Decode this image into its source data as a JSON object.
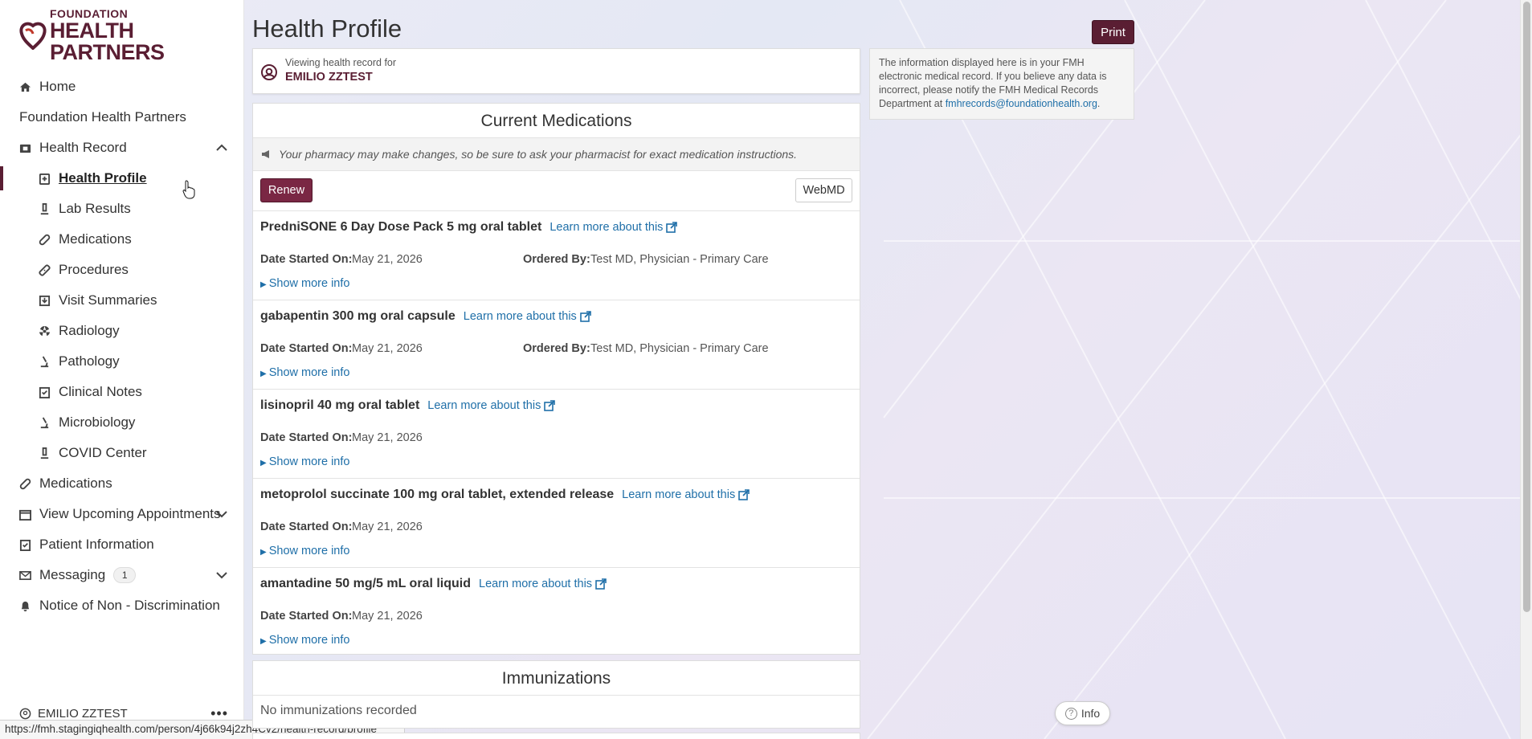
{
  "brand": {
    "small": "FOUNDATION",
    "big": "HEALTH PARTNERS",
    "color": "#5a1e33"
  },
  "sidebar": {
    "items": [
      {
        "label": "Home",
        "icon": "home-icon"
      },
      {
        "label": "Foundation Health Partners"
      },
      {
        "label": "Health Record",
        "icon": "folder-icon",
        "expanded": true
      },
      {
        "label": "Health Profile",
        "icon": "clipboard-icon",
        "active": true
      },
      {
        "label": "Lab Results",
        "icon": "flask-icon"
      },
      {
        "label": "Medications",
        "icon": "pill-icon"
      },
      {
        "label": "Procedures",
        "icon": "bandage-icon"
      },
      {
        "label": "Visit Summaries",
        "icon": "download-doc-icon"
      },
      {
        "label": "Radiology",
        "icon": "radiation-icon"
      },
      {
        "label": "Pathology",
        "icon": "microscope-icon"
      },
      {
        "label": "Clinical Notes",
        "icon": "check-doc-icon"
      },
      {
        "label": "Microbiology",
        "icon": "microscope-icon"
      },
      {
        "label": "COVID Center",
        "icon": "flask-icon"
      },
      {
        "label": "Medications",
        "icon": "pill-icon"
      },
      {
        "label": "View Upcoming Appointments",
        "icon": "calendar-icon"
      },
      {
        "label": "Patient Information",
        "icon": "check-doc-icon"
      },
      {
        "label": "Messaging",
        "icon": "envelope-icon",
        "badge": "1"
      },
      {
        "label": "Notice of Non - Discrimination",
        "icon": "bell-icon"
      }
    ],
    "user": "EMILIO ZZTEST"
  },
  "status_url": "https://fmh.stagingiqhealth.com/person/4j66k94j2zh4Cv2/health-record/profile",
  "page": {
    "title": "Health Profile",
    "print_label": "Print",
    "viewing_label": "Viewing health record for",
    "patient_name": "EMILIO ZZTEST",
    "info_text": "The information displayed here is in your FMH electronic medical record. If you believe any data is incorrect, please notify the FMH Medical Records Department at",
    "info_email": "fmhrecords@foundationhealth.org",
    "info_tail": "."
  },
  "medications": {
    "title": "Current Medications",
    "notice": "Your pharmacy may make changes, so be sure to ask your pharmacist for exact medication instructions.",
    "renew_label": "Renew",
    "webmd_label": "WebMD",
    "learn_more": "Learn more about this",
    "date_label": "Date Started On:",
    "ordered_label": "Ordered By:",
    "show_more": "Show more info",
    "items": [
      {
        "name": "PredniSONE 6 Day Dose Pack 5 mg oral tablet",
        "date": "May 21, 2026",
        "ordered_by": "Test MD, Physician - Primary Care"
      },
      {
        "name": "gabapentin 300 mg oral capsule",
        "date": "May 21, 2026",
        "ordered_by": "Test MD, Physician - Primary Care"
      },
      {
        "name": "lisinopril 40 mg oral tablet",
        "date": "May 21, 2026",
        "ordered_by": ""
      },
      {
        "name": "metoprolol succinate 100 mg oral tablet, extended release",
        "date": "May 21, 2026",
        "ordered_by": ""
      },
      {
        "name": "amantadine 50 mg/5 mL oral liquid",
        "date": "May 21, 2026",
        "ordered_by": ""
      }
    ]
  },
  "immunizations": {
    "title": "Immunizations",
    "empty": "No immunizations recorded"
  },
  "info_button": "Info"
}
